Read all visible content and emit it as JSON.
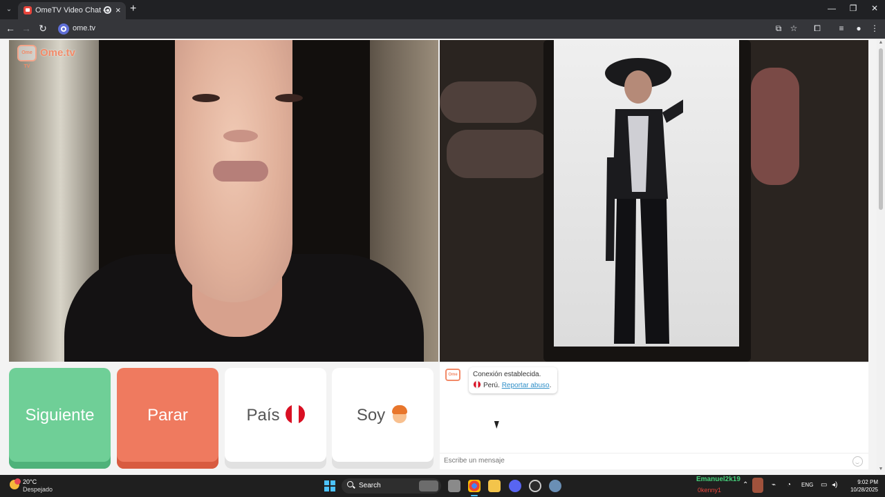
{
  "browser": {
    "tab_title": "OmeTV Video Chat — Ome",
    "url": "ome.tv"
  },
  "brand": {
    "name": "Ome.tv",
    "logo_text": "Ome TV"
  },
  "controls": {
    "next_label": "Siguiente",
    "stop_label": "Parar",
    "country_label": "País",
    "country_flag": "Perú",
    "soy_label": "Soy"
  },
  "chat": {
    "connection_text": "Conexión establecida.",
    "country_text": "Perú.",
    "report_link": "Reportar abuso",
    "report_period": ".",
    "placeholder": "Escribe un mensaje"
  },
  "taskbar": {
    "temperature": "20°C",
    "condition": "Despejado",
    "search_label": "Search",
    "notif_user1": "Emanuel2k19",
    "notif_user2": "0kenny1",
    "language": "ENG",
    "time": "9:02 PM",
    "date": "10/28/2025"
  },
  "colors": {
    "next": "#6fcf97",
    "stop": "#ef7a5f",
    "brand": "#f28a68",
    "link": "#2f8fc8"
  }
}
